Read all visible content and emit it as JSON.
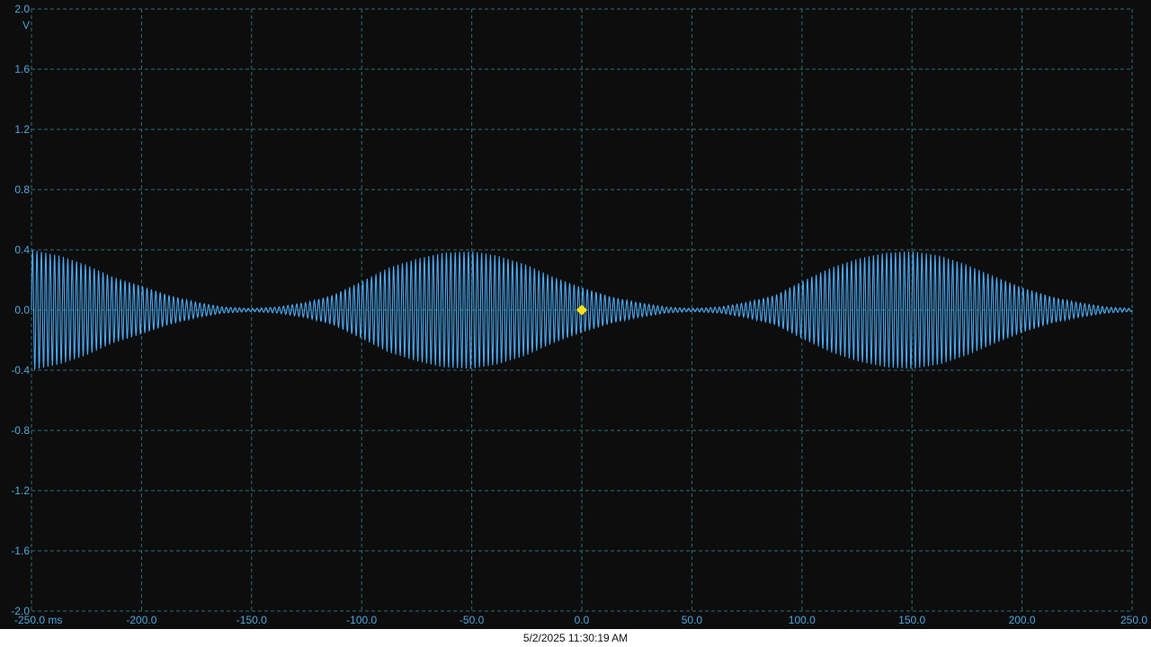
{
  "colors": {
    "background": "#0d0d0d",
    "grid": "#2e6e73",
    "axis_text": "#4ea6d8",
    "trace": "#4aa8f0",
    "trigger_marker": "#ffe11a",
    "footer_background": "#ffffff",
    "footer_text": "#111111"
  },
  "timestamp": "5/2/2025 11:30:19 AM",
  "chart_data": {
    "type": "line",
    "title": "",
    "xlabel": "",
    "ylabel": "V",
    "x_unit": "ms",
    "xlim": [
      -250,
      250
    ],
    "ylim": [
      -2.0,
      2.0
    ],
    "grid": true,
    "grid_style": "dashed",
    "x_ticks": [
      -250,
      -200,
      -150,
      -100,
      -50,
      0,
      50,
      100,
      150,
      200,
      250
    ],
    "x_tick_labels": [
      "-250.0 ms",
      "-200.0",
      "-150.0",
      "-100.0",
      "-50.0",
      "0.0",
      "50.0",
      "100.0",
      "150.0",
      "200.0",
      "250.0"
    ],
    "y_ticks": [
      2.0,
      1.6,
      1.2,
      0.8,
      0.4,
      0.0,
      -0.4,
      -0.8,
      -1.2,
      -1.6,
      -2.0
    ],
    "y_tick_labels": [
      "2.0",
      "1.6",
      "1.2",
      "0.8",
      "0.4",
      "0.0",
      "-0.4",
      "-0.8",
      "-1.2",
      "-1.6",
      "-2.0"
    ],
    "y_unit_label": "V",
    "trigger_marker": {
      "x": 0,
      "y": 0.0
    },
    "series": [
      {
        "carrier_cycles_per_ms": 0.5,
        "envelope_points": [
          [
            -250,
            0.4
          ],
          [
            -237,
            0.36
          ],
          [
            -225,
            0.3
          ],
          [
            -213,
            0.22
          ],
          [
            -200,
            0.16
          ],
          [
            -188,
            0.1
          ],
          [
            -175,
            0.05
          ],
          [
            -163,
            0.02
          ],
          [
            -150,
            0.01
          ],
          [
            -138,
            0.02
          ],
          [
            -125,
            0.05
          ],
          [
            -113,
            0.1
          ],
          [
            -100,
            0.19
          ],
          [
            -88,
            0.28
          ],
          [
            -75,
            0.34
          ],
          [
            -63,
            0.38
          ],
          [
            -50,
            0.39
          ],
          [
            -38,
            0.36
          ],
          [
            -25,
            0.3
          ],
          [
            -13,
            0.22
          ],
          [
            0,
            0.15
          ],
          [
            13,
            0.09
          ],
          [
            25,
            0.05
          ],
          [
            38,
            0.02
          ],
          [
            50,
            0.01
          ],
          [
            63,
            0.02
          ],
          [
            75,
            0.05
          ],
          [
            88,
            0.1
          ],
          [
            100,
            0.19
          ],
          [
            113,
            0.28
          ],
          [
            125,
            0.34
          ],
          [
            138,
            0.38
          ],
          [
            150,
            0.39
          ],
          [
            163,
            0.36
          ],
          [
            175,
            0.3
          ],
          [
            188,
            0.22
          ],
          [
            200,
            0.15
          ],
          [
            213,
            0.09
          ],
          [
            225,
            0.05
          ],
          [
            238,
            0.02
          ],
          [
            250,
            0.01
          ]
        ]
      }
    ]
  }
}
